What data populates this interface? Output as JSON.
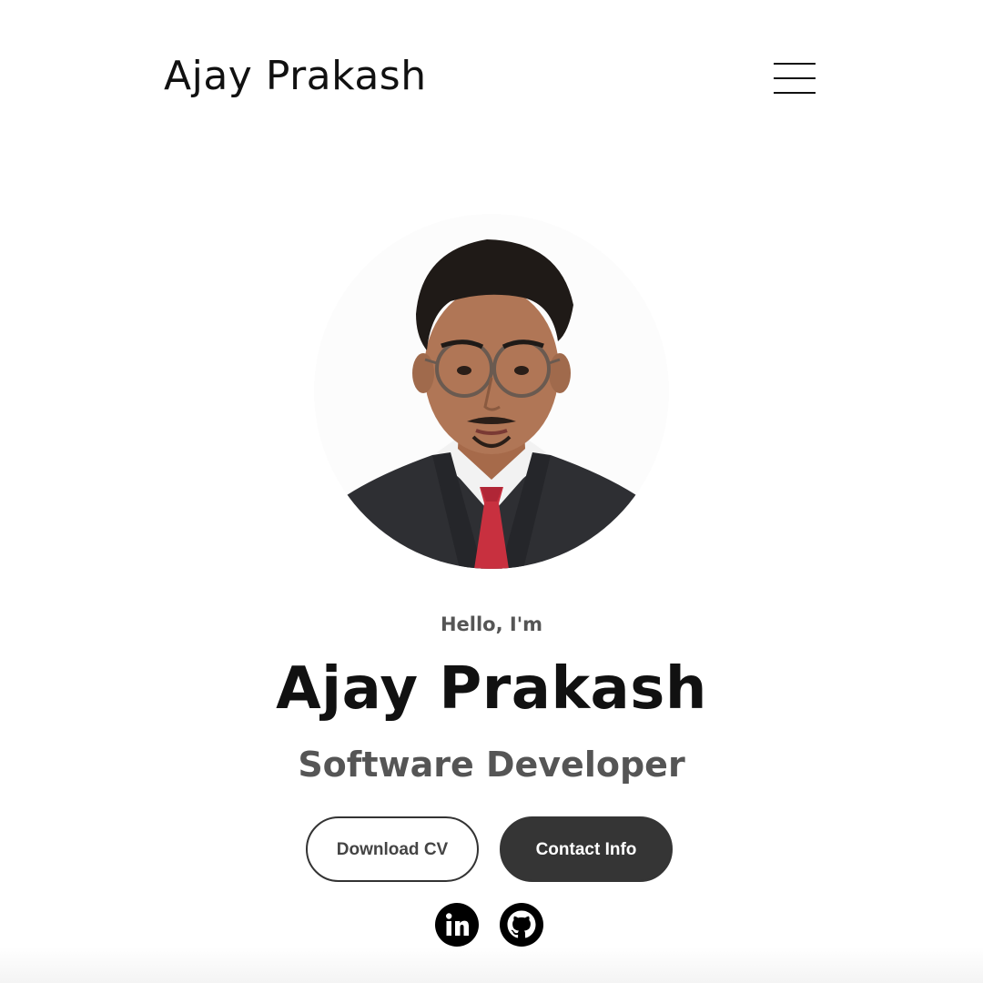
{
  "header": {
    "logo_text": "Ajay Prakash",
    "menu_icon": "hamburger-menu-icon"
  },
  "profile": {
    "greeting": "Hello, I'm",
    "name": "Ajay Prakash",
    "title": "Software Developer"
  },
  "actions": {
    "download_cv_label": "Download CV",
    "contact_info_label": "Contact Info"
  },
  "social": {
    "icons": [
      "linkedin-icon",
      "github-icon"
    ]
  },
  "colors": {
    "primary_text": "#111111",
    "secondary_text": "#555555",
    "button_dark": "#353535"
  }
}
